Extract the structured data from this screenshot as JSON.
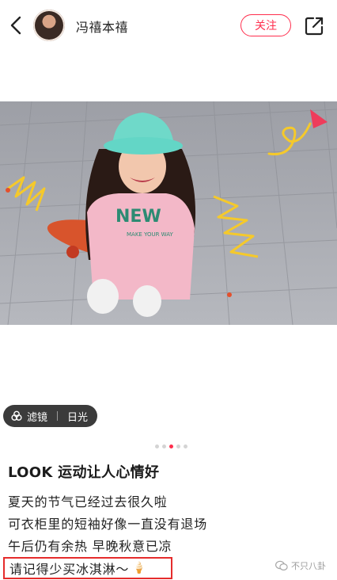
{
  "header": {
    "username": "冯禧本禧",
    "follow_label": "关注"
  },
  "filter": {
    "label": "滤镜",
    "value": "日光"
  },
  "carousel": {
    "count": 5,
    "active_index": 2
  },
  "post": {
    "title": "LOOK 运动让人心情好",
    "lines": [
      "夏天的节气已经过去很久啦",
      "可衣柜里的短袖好像一直没有退场",
      "午后仍有余热 早晚秋意已凉",
      "请记得少买冰淇淋～"
    ],
    "emoji": "🍦"
  },
  "watermark": {
    "text": "不只八卦"
  },
  "photo_print": {
    "line1": "NEW",
    "line2": "MAKE YOUR WAY"
  },
  "colors": {
    "accent": "#ff2e4d",
    "highlight_box": "#e52c2c",
    "hat": "#63d6c6",
    "shirt": "#f3b8c8"
  },
  "icons": [
    "back-arrow-icon",
    "share-icon",
    "filter-icon",
    "wechat-icon"
  ]
}
